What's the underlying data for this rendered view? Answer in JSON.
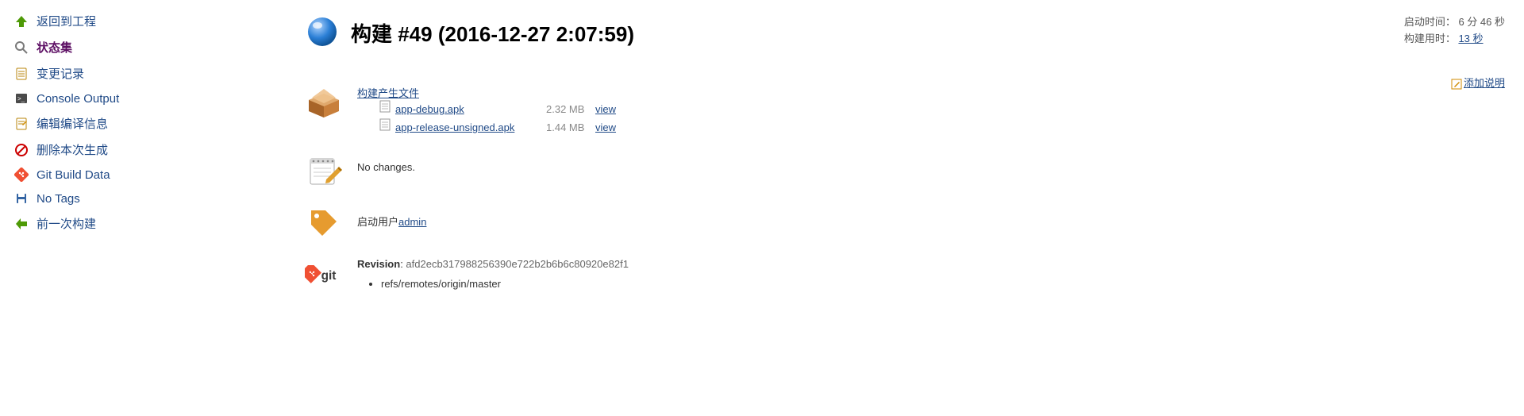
{
  "sidebar": {
    "items": [
      {
        "label": "返回到工程"
      },
      {
        "label": "状态集"
      },
      {
        "label": "变更记录"
      },
      {
        "label": "Console Output"
      },
      {
        "label": "编辑编译信息"
      },
      {
        "label": "删除本次生成"
      },
      {
        "label": "Git Build Data"
      },
      {
        "label": "No Tags"
      },
      {
        "label": "前一次构建"
      }
    ]
  },
  "header": {
    "title": "构建 #49 (2016-12-27 2:07:59)"
  },
  "meta": {
    "start_label": "启动时间：",
    "start_value": "6 分 46 秒",
    "duration_label": "构建用时： ",
    "duration_value": "13 秒"
  },
  "add_description": "添加说明",
  "artifacts": {
    "title": "构建产生文件",
    "items": [
      {
        "name": "app-debug.apk",
        "size": "2.32 MB",
        "view": "view"
      },
      {
        "name": "app-release-unsigned.apk",
        "size": "1.44 MB",
        "view": "view"
      }
    ]
  },
  "changes": {
    "text": "No changes."
  },
  "cause": {
    "prefix": "启动用户",
    "user": "admin"
  },
  "git": {
    "revision_label": "Revision",
    "revision": "afd2ecb317988256390e722b2b6b6c80920e82f1",
    "refs": [
      "refs/remotes/origin/master"
    ]
  }
}
